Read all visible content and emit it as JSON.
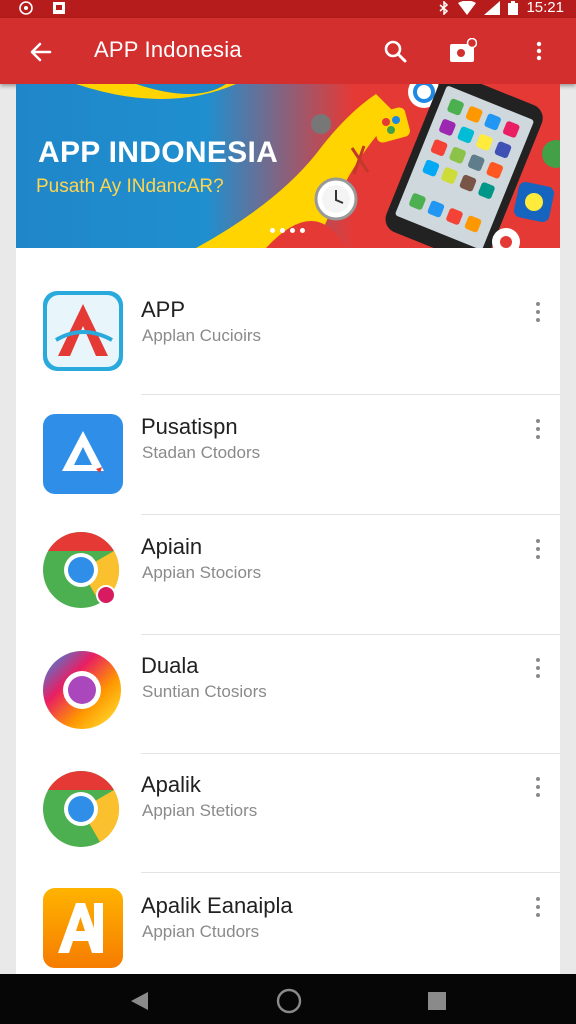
{
  "status_bar": {
    "time": "15:21",
    "icons": [
      "settings-icon",
      "notification-icon",
      "bluetooth-icon",
      "wifi-icon",
      "signal-icon",
      "battery-icon"
    ]
  },
  "toolbar": {
    "title": "APP Indonesia",
    "icons": [
      "back-arrow-icon",
      "search-icon",
      "camera-icon",
      "more-vert-icon"
    ]
  },
  "banner": {
    "title": "APP INDONESIA",
    "subtitle": "Pusath Ay INdancAR?"
  },
  "apps": [
    {
      "name": "APP",
      "subtitle": "Applan Cucioirs",
      "icon": "red-a-app-icon"
    },
    {
      "name": "Pusatispn",
      "subtitle": "Stadan Ctodors",
      "icon": "blue-triangle-app-icon"
    },
    {
      "name": "Apiain",
      "subtitle": "Appian Stociors",
      "icon": "chrome-style-app-icon"
    },
    {
      "name": "Duala",
      "subtitle": "Suntian Ctosiors",
      "icon": "rainbow-ring-app-icon"
    },
    {
      "name": "Apalik",
      "subtitle": "Appian Stetiors",
      "icon": "chrome-app-icon"
    },
    {
      "name": "Apalik Eanaipla",
      "subtitle": "Appian Ctudors",
      "icon": "orange-a-app-icon"
    }
  ],
  "colors": {
    "toolbar": "#d32f2f",
    "status_bar": "#b71c1c",
    "navbar": "#060606"
  },
  "nav_bar": {
    "icons": [
      "back-nav-icon",
      "home-nav-icon",
      "recents-nav-icon"
    ]
  }
}
